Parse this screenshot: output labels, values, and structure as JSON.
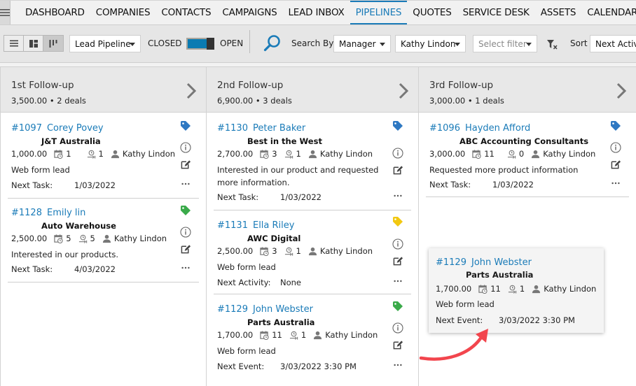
{
  "nav": {
    "menu_icon": "hamburger-icon",
    "items": [
      {
        "label": "DASHBOARD"
      },
      {
        "label": "COMPANIES"
      },
      {
        "label": "CONTACTS"
      },
      {
        "label": "CAMPAIGNS"
      },
      {
        "label": "LEAD INBOX"
      },
      {
        "label": "PIPELINES",
        "active": true
      },
      {
        "label": "QUOTES"
      },
      {
        "label": "SERVICE DESK"
      },
      {
        "label": "ASSETS"
      },
      {
        "label": "CALENDAR"
      }
    ]
  },
  "toolbar": {
    "view_modes": [
      "list-view-icon",
      "tile-view-icon",
      "kanban-view-icon"
    ],
    "active_view": "kanban-view-icon",
    "pipeline_select": "Lead Pipeline",
    "closed_label": "CLOSED",
    "open_label": "OPEN",
    "toggle_state": "OPEN",
    "search_icon": "search-icon",
    "search_by_label": "Search By",
    "search_by_select": "Manager",
    "manager_select": "Kathy Lindon",
    "filter_placeholder": "Select filter",
    "clear_filter_icon": "clear-filter-icon",
    "sort_label": "Sort",
    "sort_select": "Next Activity"
  },
  "colors": {
    "accent": "#1a7bb8",
    "tag_blue": "#2e78c2",
    "tag_green": "#3aaa4a",
    "tag_yellow": "#f2c811",
    "arrow_red": "#f2454d"
  },
  "columns": [
    {
      "title": "1st Follow-up",
      "summary": "3,500.00 • 2 deals",
      "cards": [
        {
          "num": "#1097",
          "name": "Corey Povey",
          "company": "J&T Australia",
          "amount": "1,000.00",
          "activities": "1",
          "tasks": "1",
          "owner": "Kathy Lindon",
          "desc": "Web form lead",
          "next_label": "Next Task:",
          "next_value": "1/03/2022",
          "tag": "blue"
        },
        {
          "num": "#1128",
          "name": "Emily lin",
          "company": "Auto Warehouse",
          "amount": "2,500.00",
          "activities": "5",
          "tasks": "5",
          "owner": "Kathy Lindon",
          "desc": "Interested in our products.",
          "next_label": "Next Task:",
          "next_value": "4/03/2022",
          "tag": "green"
        }
      ]
    },
    {
      "title": "2nd Follow-up",
      "summary": "6,900.00 • 3 deals",
      "cards": [
        {
          "num": "#1130",
          "name": "Peter Baker",
          "company": "Best in the West",
          "amount": "2,700.00",
          "activities": "3",
          "tasks": "1",
          "owner": "Kathy Lindon",
          "desc": "Interested in our product and requested more information.",
          "next_label": "Next Task:",
          "next_value": "1/03/2022",
          "tag": "blue"
        },
        {
          "num": "#1131",
          "name": "Ella Riley",
          "company": "AWC Digital",
          "amount": "2,500.00",
          "activities": "3",
          "tasks": "1",
          "owner": "Kathy Lindon",
          "desc": "Web form lead",
          "next_label": "Next Activity:",
          "next_value": "None",
          "tag": "yellow"
        },
        {
          "num": "#1129",
          "name": "John Webster",
          "company": "Parts Australia",
          "amount": "1,700.00",
          "activities": "11",
          "tasks": "1",
          "owner": "Kathy Lindon",
          "desc": "Web form lead",
          "next_label": "Next Event:",
          "next_value": "3/03/2022 3:30 PM",
          "tag": "green"
        }
      ]
    },
    {
      "title": "3rd Follow-up",
      "summary": "3,000.00 • 1 deals",
      "cards": [
        {
          "num": "#1096",
          "name": "Hayden Afford",
          "company": "ABC Accounting Consultants",
          "amount": "3,000.00",
          "activities": "11",
          "tasks": "0",
          "owner": "Kathy Lindon",
          "desc": "Requested more product information",
          "next_label": "Next Task:",
          "next_value": "1/03/2022",
          "tag": "blue"
        }
      ]
    }
  ],
  "dragging_card": {
    "num": "#1129",
    "name": "John Webster",
    "company": "Parts Australia",
    "amount": "1,700.00",
    "activities": "11",
    "tasks": "1",
    "owner": "Kathy Lindon",
    "desc": "Web form lead",
    "next_label": "Next Event:",
    "next_value": "3/03/2022 3:30 PM"
  }
}
